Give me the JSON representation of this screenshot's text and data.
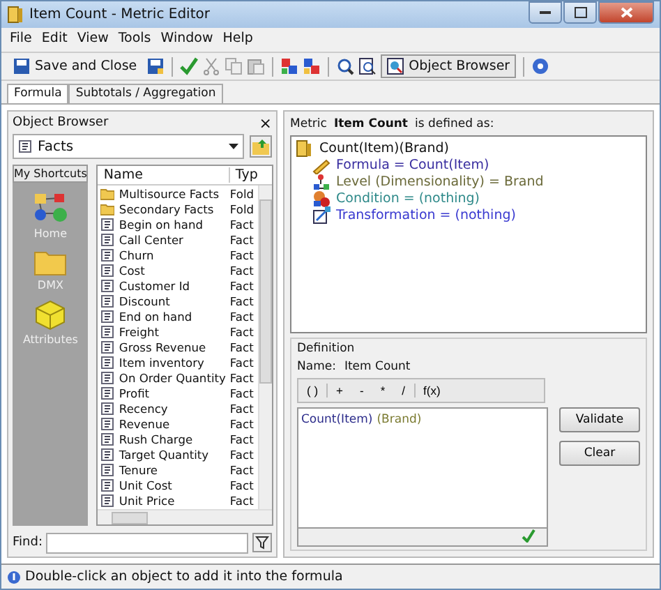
{
  "window": {
    "title": "Item Count - Metric Editor"
  },
  "menu": [
    "File",
    "Edit",
    "View",
    "Tools",
    "Window",
    "Help"
  ],
  "toolbar": {
    "save_close": "Save and Close",
    "object_browser": "Object Browser"
  },
  "tabs": [
    {
      "label": "Formula",
      "selected": true
    },
    {
      "label": "Subtotals / Aggregation",
      "selected": false
    }
  ],
  "object_browser": {
    "title": "Object Browser",
    "close": "×",
    "folder": "Facts",
    "shortcuts_title": "My Shortcuts",
    "shortcuts": [
      {
        "label": "Home",
        "kind": "home"
      },
      {
        "label": "DMX",
        "kind": "folder"
      },
      {
        "label": "Attributes",
        "kind": "cube"
      }
    ],
    "columns": [
      "Name",
      "Typ"
    ],
    "rows": [
      {
        "name": "Multisource Facts",
        "type": "Fold",
        "kind": "folder"
      },
      {
        "name": "Secondary Facts",
        "type": "Fold",
        "kind": "folder"
      },
      {
        "name": "Begin on hand",
        "type": "Fact",
        "kind": "fact"
      },
      {
        "name": "Call Center",
        "type": "Fact",
        "kind": "fact"
      },
      {
        "name": "Churn",
        "type": "Fact",
        "kind": "fact"
      },
      {
        "name": "Cost",
        "type": "Fact",
        "kind": "fact"
      },
      {
        "name": "Customer Id",
        "type": "Fact",
        "kind": "fact"
      },
      {
        "name": "Discount",
        "type": "Fact",
        "kind": "fact"
      },
      {
        "name": "End on hand",
        "type": "Fact",
        "kind": "fact"
      },
      {
        "name": "Freight",
        "type": "Fact",
        "kind": "fact"
      },
      {
        "name": "Gross Revenue",
        "type": "Fact",
        "kind": "fact"
      },
      {
        "name": "Item inventory",
        "type": "Fact",
        "kind": "fact"
      },
      {
        "name": "On Order Quantity",
        "type": "Fact",
        "kind": "fact"
      },
      {
        "name": "Profit",
        "type": "Fact",
        "kind": "fact"
      },
      {
        "name": "Recency",
        "type": "Fact",
        "kind": "fact"
      },
      {
        "name": "Revenue",
        "type": "Fact",
        "kind": "fact"
      },
      {
        "name": "Rush Charge",
        "type": "Fact",
        "kind": "fact"
      },
      {
        "name": "Target Quantity",
        "type": "Fact",
        "kind": "fact"
      },
      {
        "name": "Tenure",
        "type": "Fact",
        "kind": "fact"
      },
      {
        "name": "Unit Cost",
        "type": "Fact",
        "kind": "fact"
      },
      {
        "name": "Unit Price",
        "type": "Fact",
        "kind": "fact"
      }
    ],
    "find_label": "Find:"
  },
  "metric": {
    "prefix": "Metric",
    "name": "Item Count",
    "suffix": "is defined as:",
    "root": "Count(Item)(Brand)",
    "items": [
      {
        "text": "Formula = Count(Item)",
        "kind": "formula",
        "color": "#3a2fa0"
      },
      {
        "text": "Level (Dimensionality) = Brand",
        "kind": "level",
        "color": "#6b6a3a"
      },
      {
        "text": "Condition = (nothing)",
        "kind": "condition",
        "color": "#2f8a8a"
      },
      {
        "text": "Transformation = (nothing)",
        "kind": "transformation",
        "color": "#3a3ad0"
      }
    ]
  },
  "definition": {
    "title": "Definition",
    "name_label": "Name:",
    "name": "Item Count",
    "operators": [
      "( )",
      "+",
      "-",
      "*",
      "/",
      "f(x)"
    ],
    "tokens": [
      {
        "text": "Count(Item)",
        "color": "#2b2b8a"
      },
      {
        "text": "(Brand)",
        "color": "#7a7a30"
      }
    ],
    "buttons": [
      "Validate",
      "Clear"
    ],
    "valid": true
  },
  "status_bar": "Double-click an object to add it into the formula"
}
